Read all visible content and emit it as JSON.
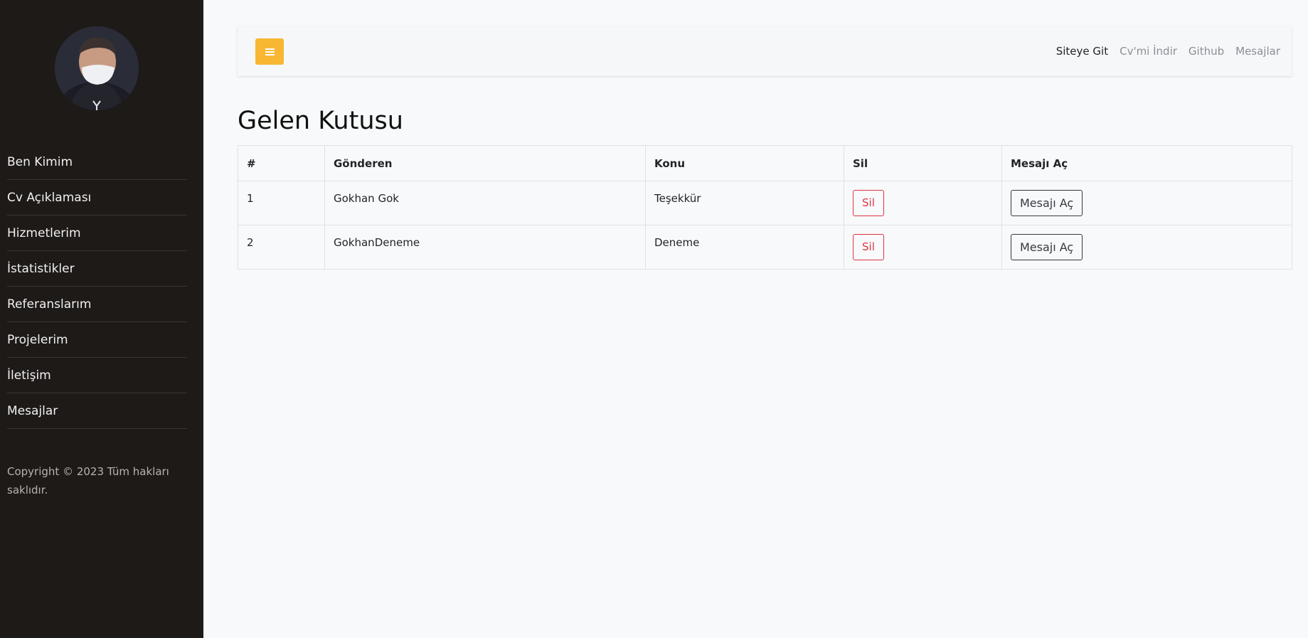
{
  "sidebar": {
    "avatar_alt": "profile photo",
    "items": [
      {
        "label": "Ben Kimim"
      },
      {
        "label": "Cv Açıklaması"
      },
      {
        "label": "Hizmetlerim"
      },
      {
        "label": "İstatistikler"
      },
      {
        "label": "Referanslarım"
      },
      {
        "label": "Projelerim"
      },
      {
        "label": "İletişim"
      },
      {
        "label": "Mesajlar"
      }
    ],
    "copyright": "Copyright © 2023 Tüm hakları saklıdır."
  },
  "topbar": {
    "toggle_icon": "menu-bars-icon",
    "links": [
      {
        "label": "Siteye Git",
        "active": true
      },
      {
        "label": "Cv'mi İndir",
        "active": false
      },
      {
        "label": "Github",
        "active": false
      },
      {
        "label": "Mesajlar",
        "active": false
      }
    ]
  },
  "main": {
    "title": "Gelen Kutusu",
    "table": {
      "headers": [
        "#",
        "Gönderen",
        "Konu",
        "Sil",
        "Mesajı Aç"
      ],
      "rows": [
        {
          "id": "1",
          "sender": "Gokhan Gok",
          "subject": "Teşekkür",
          "delete_label": "Sil",
          "open_label": "Mesajı Aç"
        },
        {
          "id": "2",
          "sender": "GokhanDeneme",
          "subject": "Deneme",
          "delete_label": "Sil",
          "open_label": "Mesajı Aç"
        }
      ]
    }
  },
  "colors": {
    "sidebar_bg": "#1e1a18",
    "accent": "#f7b733",
    "danger": "#dc3545",
    "dark": "#343a40"
  }
}
